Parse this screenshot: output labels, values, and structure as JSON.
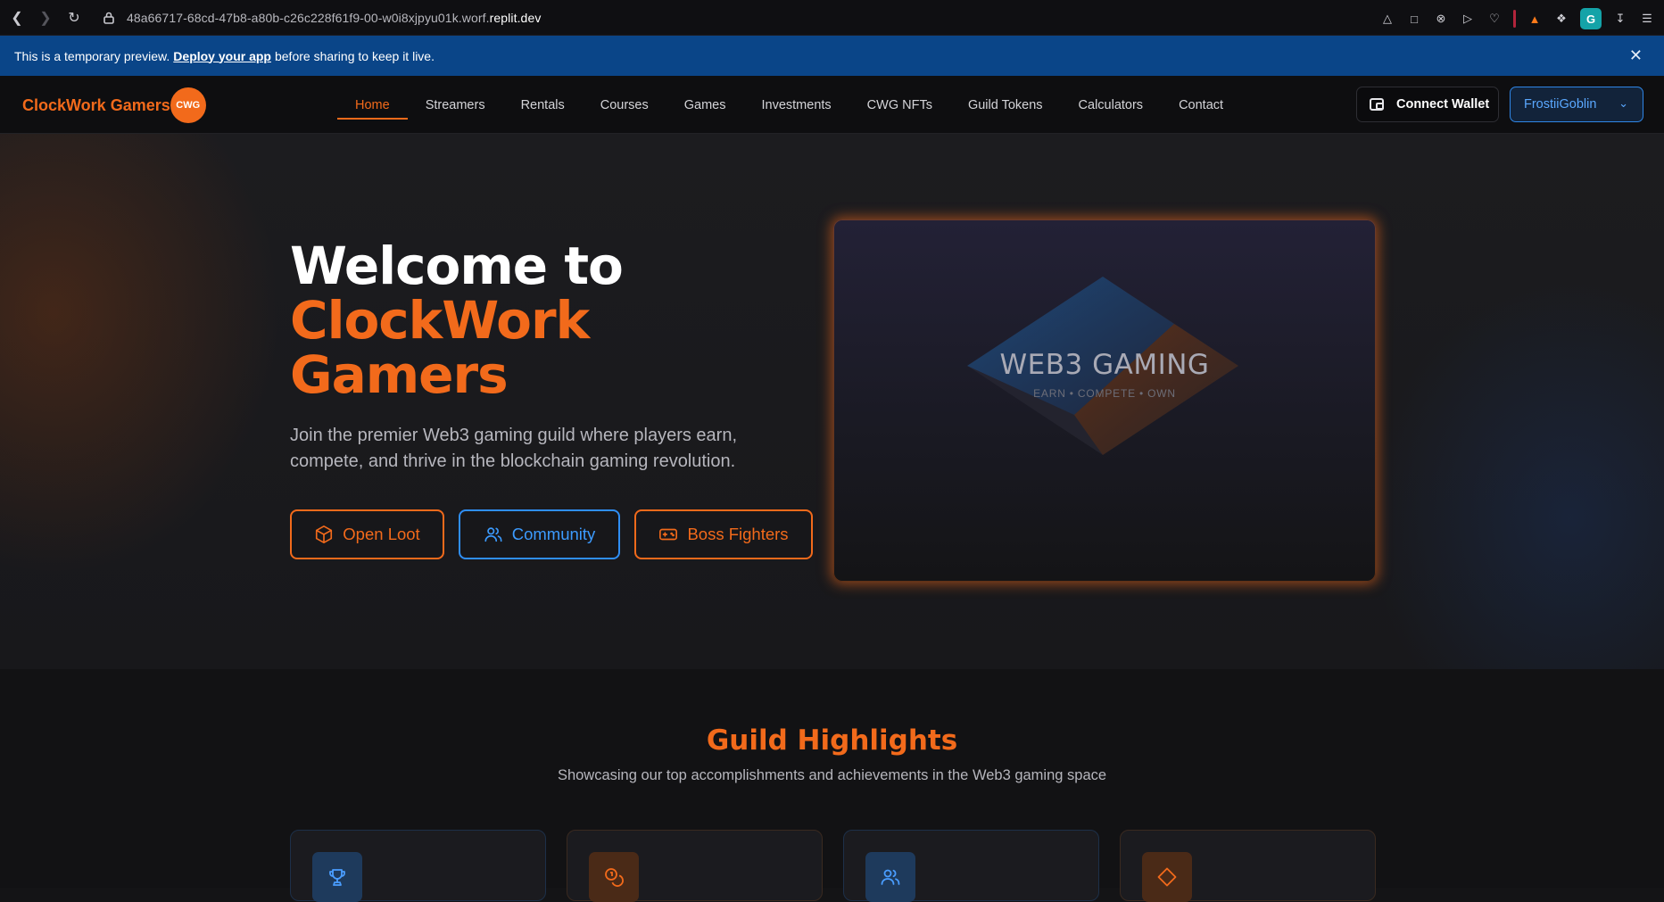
{
  "browser": {
    "url_path": "48a66717-68cd-47b8-a80b-c26c228f61f9-00-w0i8xjpyu01k.worf.",
    "url_host": "replit.dev",
    "profile_initial": "G"
  },
  "banner": {
    "text_before": "This is a temporary preview.",
    "link": "Deploy your app",
    "text_after": "before sharing to keep it live.",
    "close": "✕"
  },
  "header": {
    "brand": "ClockWork Gamers",
    "badge": "CWG",
    "nav": [
      "Home",
      "Streamers",
      "Rentals",
      "Courses",
      "Games",
      "Investments",
      "CWG NFTs",
      "Guild Tokens",
      "Calculators",
      "Contact"
    ],
    "active_index": 0,
    "connect_wallet": "Connect Wallet",
    "user": "FrostiiGoblin"
  },
  "hero": {
    "title_line1": "Welcome to",
    "title_line2": "ClockWork",
    "title_line3": "Gamers",
    "subtitle": "Join the premier Web3 gaming guild where players earn, compete, and thrive in the blockchain gaming revolution.",
    "buttons": {
      "open_loot": "Open Loot",
      "community": "Community",
      "boss_fighters": "Boss Fighters"
    },
    "card_title": "WEB3 GAMING",
    "card_subtitle": "EARN • COMPETE • OWN"
  },
  "highlights": {
    "title": "Guild Highlights",
    "subtitle": "Showcasing our top accomplishments and achievements in the Web3 gaming space",
    "cards": [
      {
        "icon": "trophy-icon",
        "color": "blue"
      },
      {
        "icon": "coins-icon",
        "color": "orange"
      },
      {
        "icon": "users-icon",
        "color": "blue"
      },
      {
        "icon": "diamond-icon",
        "color": "orange"
      }
    ]
  },
  "colors": {
    "accent_orange": "#f26a1b",
    "accent_blue": "#2f8ef5",
    "banner_blue": "#0a4588",
    "background": "#141416"
  }
}
